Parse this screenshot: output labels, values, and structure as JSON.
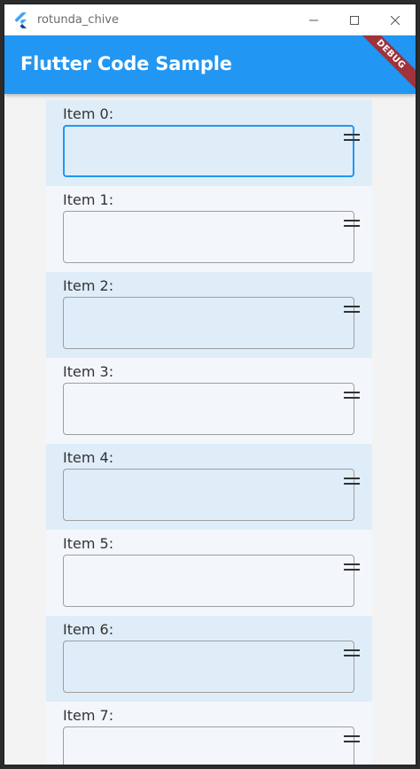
{
  "window": {
    "title": "rotunda_chive"
  },
  "appbar": {
    "title": "Flutter Code Sample",
    "debug_banner": "DEBUG"
  },
  "colors": {
    "primary": "#2196f3",
    "debug_banner": "#a0323c",
    "item_odd": "#dfedf9",
    "item_even": "#f3f7fc"
  },
  "items": [
    {
      "label": "Item 0:",
      "focused": true
    },
    {
      "label": "Item 1:",
      "focused": false
    },
    {
      "label": "Item 2:",
      "focused": false
    },
    {
      "label": "Item 3:",
      "focused": false
    },
    {
      "label": "Item 4:",
      "focused": false
    },
    {
      "label": "Item 5:",
      "focused": false
    },
    {
      "label": "Item 6:",
      "focused": false
    },
    {
      "label": "Item 7:",
      "focused": false
    }
  ]
}
